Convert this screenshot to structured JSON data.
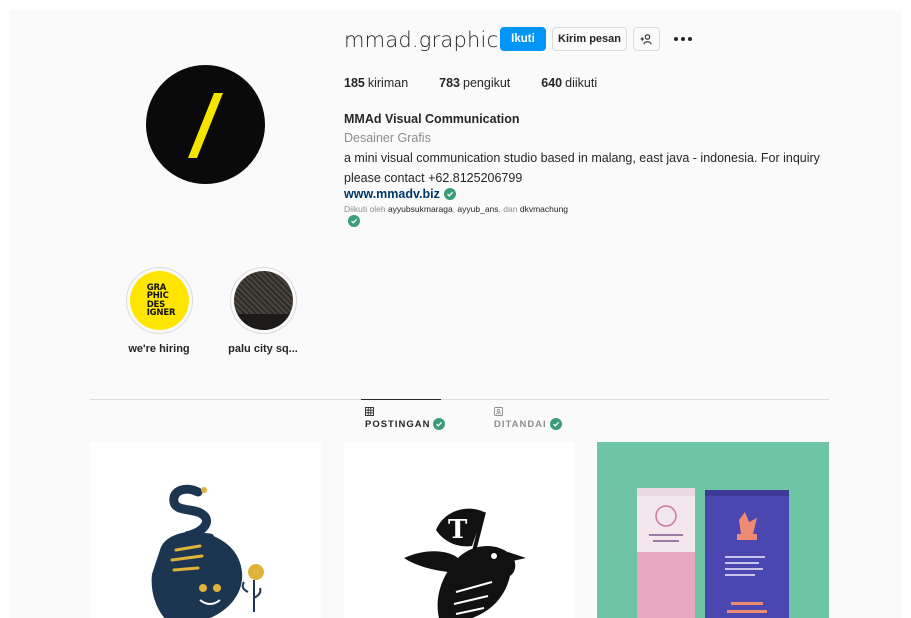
{
  "profile": {
    "username": "mmad.graphic",
    "follow_label": "Ikuti",
    "message_label": "Kirim pesan",
    "more_icon": "more-options-icon",
    "suggest_icon": "add-person-icon"
  },
  "stats": {
    "posts_count": "185",
    "posts_label": "kiriman",
    "followers_count": "783",
    "followers_label": "pengikut",
    "following_count": "640",
    "following_label": "diikuti"
  },
  "bio": {
    "name": "MMAd Visual Communication",
    "category": "Desainer Grafis",
    "text": "a mini visual communication studio based in malang, east java - indonesia. For inquiry please contact +62.8125206799",
    "link": "www.mmadv.biz",
    "followed_by_prefix": "Diikuti oleh",
    "followed_by_1": "ayyubsukmaraga",
    "followed_by_2": "ayyub_ans",
    "followed_by_sep": "dan",
    "followed_by_3": "dkvmachung"
  },
  "highlights": [
    {
      "label": "we're hiring",
      "cover_text": "GRA\nPHIC\nDES\nIGNER"
    },
    {
      "label": "palu city sq..."
    }
  ],
  "tabs": [
    {
      "label": "POSTINGAN",
      "active": true
    },
    {
      "label": "DITANDAI",
      "active": false
    }
  ],
  "colors": {
    "accent": "#0095f6",
    "verified": "#3b9c7c",
    "link": "#00376b",
    "avatar_slash": "#f5e300"
  }
}
